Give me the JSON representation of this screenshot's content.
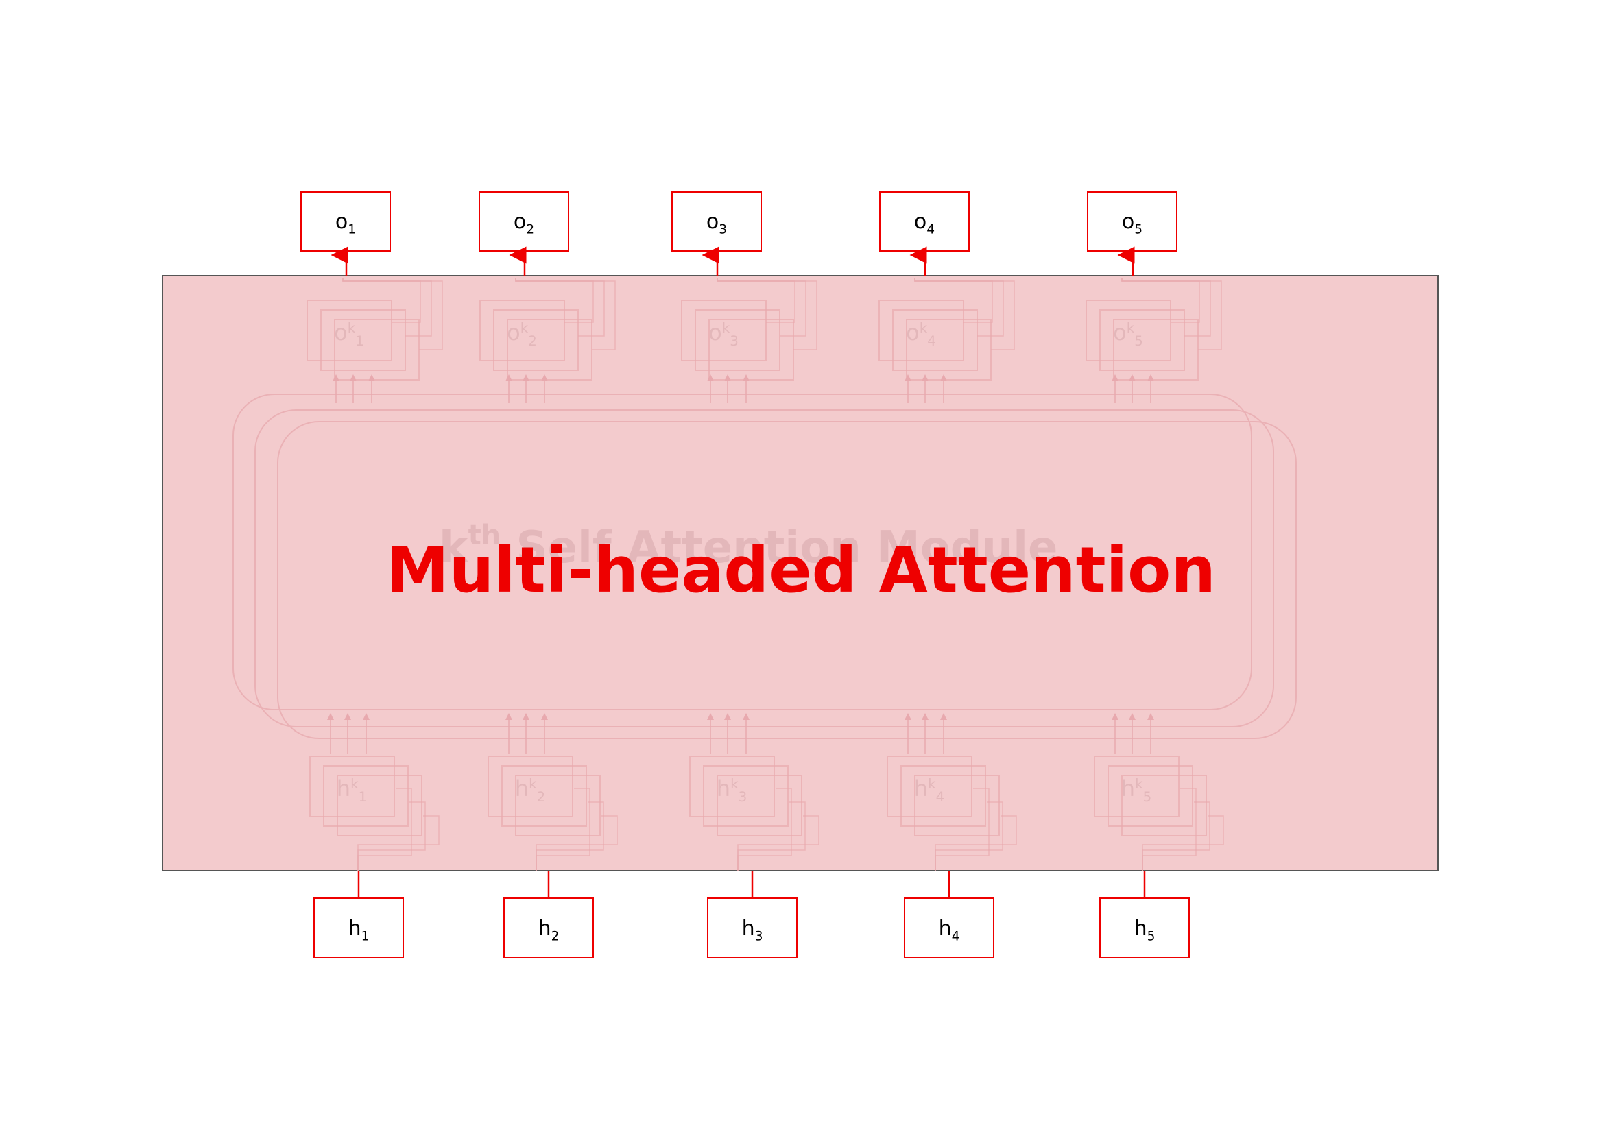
{
  "diagram": {
    "title": "Multi-headed Attention",
    "background_title": "kth Self Attention Module",
    "background_title_base": "k",
    "background_title_sup": "th",
    "background_title_rest": " Self Attention Module",
    "inputs": [
      {
        "base": "h",
        "sub": "1"
      },
      {
        "base": "h",
        "sub": "2"
      },
      {
        "base": "h",
        "sub": "3"
      },
      {
        "base": "h",
        "sub": "4"
      },
      {
        "base": "h",
        "sub": "5"
      }
    ],
    "outputs": [
      {
        "base": "o",
        "sub": "1"
      },
      {
        "base": "o",
        "sub": "2"
      },
      {
        "base": "o",
        "sub": "3"
      },
      {
        "base": "o",
        "sub": "4"
      },
      {
        "base": "o",
        "sub": "5"
      }
    ],
    "head_outputs": [
      {
        "base": "o",
        "sup": "k",
        "sub": "1"
      },
      {
        "base": "o",
        "sup": "k",
        "sub": "2"
      },
      {
        "base": "o",
        "sup": "k",
        "sub": "3"
      },
      {
        "base": "o",
        "sup": "k",
        "sub": "4"
      },
      {
        "base": "o",
        "sup": "k",
        "sub": "5"
      }
    ],
    "head_inputs": [
      {
        "base": "h",
        "sup": "k",
        "sub": "1"
      },
      {
        "base": "h",
        "sup": "k",
        "sub": "2"
      },
      {
        "base": "h",
        "sup": "k",
        "sub": "3"
      },
      {
        "base": "h",
        "sup": "k",
        "sub": "4"
      },
      {
        "base": "h",
        "sup": "k",
        "sub": "5"
      }
    ],
    "colors": {
      "accent": "#ee0000",
      "overlay_fill": "#f3cbcd",
      "overlay_stroke": "#555555",
      "ghost_text": "#e3b7ba",
      "ghost_stroke": "#e8a9ae",
      "black": "#000000",
      "white": "#ffffff"
    }
  }
}
